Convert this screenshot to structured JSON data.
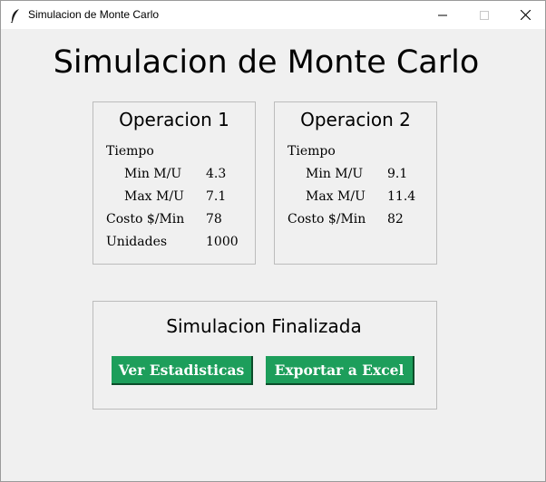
{
  "window": {
    "title": "Simulacion de Monte Carlo",
    "icon": "feather-icon"
  },
  "main_title": "Simulacion de Monte Carlo",
  "operations": [
    {
      "title": "Operacion 1",
      "tiempo_label": "Tiempo",
      "min_label": "Min M/U",
      "min_value": "4.3",
      "max_label": "Max M/U",
      "max_value": "7.1",
      "costo_label": "Costo $/Min",
      "costo_value": "78",
      "unidades_label": "Unidades",
      "unidades_value": "1000"
    },
    {
      "title": "Operacion 2",
      "tiempo_label": "Tiempo",
      "min_label": "Min M/U",
      "min_value": "9.1",
      "max_label": "Max M/U",
      "max_value": "11.4",
      "costo_label": "Costo $/Min",
      "costo_value": "82"
    }
  ],
  "status": {
    "text": "Simulacion Finalizada",
    "stats_button": "Ver Estadisticas",
    "export_button": "Exportar a Excel",
    "button_color": "#1d9e5b"
  }
}
